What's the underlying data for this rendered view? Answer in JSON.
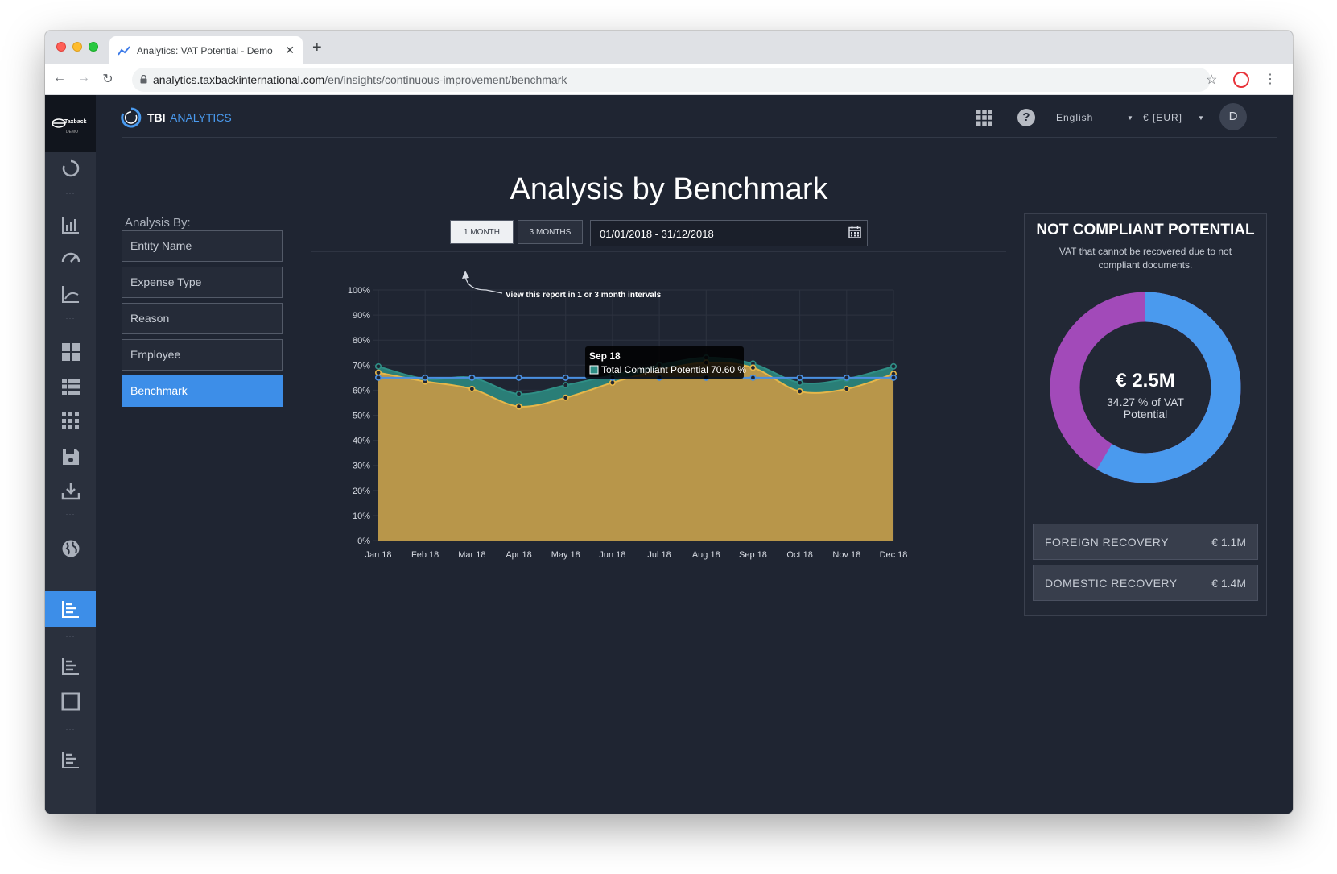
{
  "browser": {
    "tab_title": "Analytics: VAT Potential - Demo",
    "url_host": "analytics.taxbackinternational.com",
    "url_path": "/en/insights/continuous-improvement/benchmark"
  },
  "brand": {
    "logo_text": "Taxback",
    "logo_sub": "DEMO",
    "tbi": "TBI",
    "analytics": "ANALYTICS"
  },
  "header": {
    "language": "English",
    "currency": "€ [EUR]",
    "avatar_letter": "D"
  },
  "page": {
    "title": "Analysis by Benchmark"
  },
  "analysis": {
    "label": "Analysis By:",
    "items": [
      "Entity Name",
      "Expense Type",
      "Reason",
      "Employee",
      "Benchmark"
    ],
    "active": "Benchmark"
  },
  "controls": {
    "btn_1month": "1 MONTH",
    "btn_3months": "3 MONTHS",
    "date_range": "01/01/2018 - 31/12/2018",
    "hint": "View this report in 1 or 3 month intervals"
  },
  "tooltip": {
    "title": "Sep 18",
    "label": "Total Compliant Potential 70.60 %"
  },
  "chart_data": {
    "type": "area",
    "categories": [
      "Jan 18",
      "Feb 18",
      "Mar 18",
      "Apr 18",
      "May 18",
      "Jun 18",
      "Jul 18",
      "Aug 18",
      "Sep 18",
      "Oct 18",
      "Nov 18",
      "Dec 18"
    ],
    "ylim": [
      0,
      100
    ],
    "yticks": [
      "0%",
      "10%",
      "20%",
      "30%",
      "40%",
      "50%",
      "60%",
      "70%",
      "80%",
      "90%",
      "100%"
    ],
    "series": [
      {
        "name": "Total Compliant Potential",
        "color": "#2f8f86",
        "values": [
          69.5,
          64.5,
          65,
          58.5,
          62,
          66,
          70,
          73,
          70.6,
          63,
          64.5,
          69.5
        ]
      },
      {
        "color": "#e6b74a",
        "values": [
          67,
          63.5,
          60.5,
          53.5,
          57,
          63,
          68,
          71,
          69,
          59.5,
          60.5,
          66.5
        ]
      },
      {
        "color": "#4a90e2",
        "values": [
          65,
          65,
          65,
          65,
          65,
          65,
          65,
          65,
          65,
          65,
          65,
          65
        ]
      }
    ]
  },
  "panel": {
    "title": "NOT COMPLIANT POTENTIAL",
    "subtitle": "VAT that cannot be recovered due to not compliant documents.",
    "total": "€ 2.5M",
    "percent": "34.27 % of VAT Potential",
    "donut": {
      "blue_color": "#4a9aee",
      "purple_color": "#a24ab9",
      "blue_fraction": 0.585
    },
    "foreign_label": "FOREIGN RECOVERY",
    "foreign_value": "€ 1.1M",
    "domestic_label": "DOMESTIC RECOVERY",
    "domestic_value": "€ 1.4M"
  }
}
